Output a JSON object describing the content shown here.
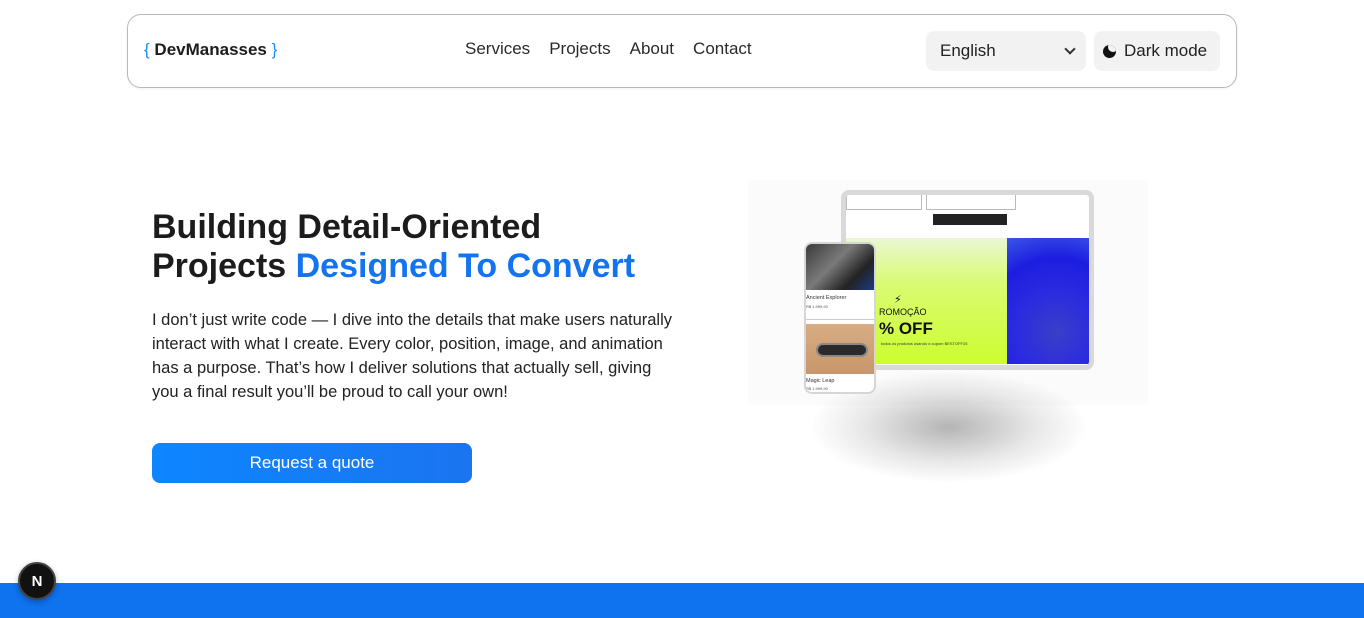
{
  "nav": {
    "logo_open": "{",
    "logo_text": "DevManasses",
    "logo_close": "}",
    "links": [
      "Services",
      "Projects",
      "About",
      "Contact"
    ],
    "language": "English",
    "dark_mode_label": "Dark mode"
  },
  "hero": {
    "title_line1": "Building Detail-Oriented",
    "title_line2_plain": "Projects ",
    "title_line2_accent": "Designed To Convert",
    "description": "I don’t just write code — I dive into the details that make users naturally interact with what I create. Every color, position, image, and animation has a purpose. That’s how I deliver solutions that actually sell, giving you a final result you’ll be proud to call your own!",
    "cta_label": "Request a quote"
  },
  "mockup": {
    "promo_label": "ROMOÇÃO",
    "promo_off": "% OFF",
    "promo_small": "todos os produtos usando o cupom BESTOFF25",
    "product1_name": "Ancient Explorer",
    "product1_price": "R$ 1.999,90",
    "product2_name": "Magic Leap",
    "product2_price": "R$ 1.999,90"
  },
  "badge": {
    "letter": "N"
  },
  "colors": {
    "accent": "#1474f0",
    "band": "#0f72ef",
    "promo_green": "#cdfd2e"
  }
}
